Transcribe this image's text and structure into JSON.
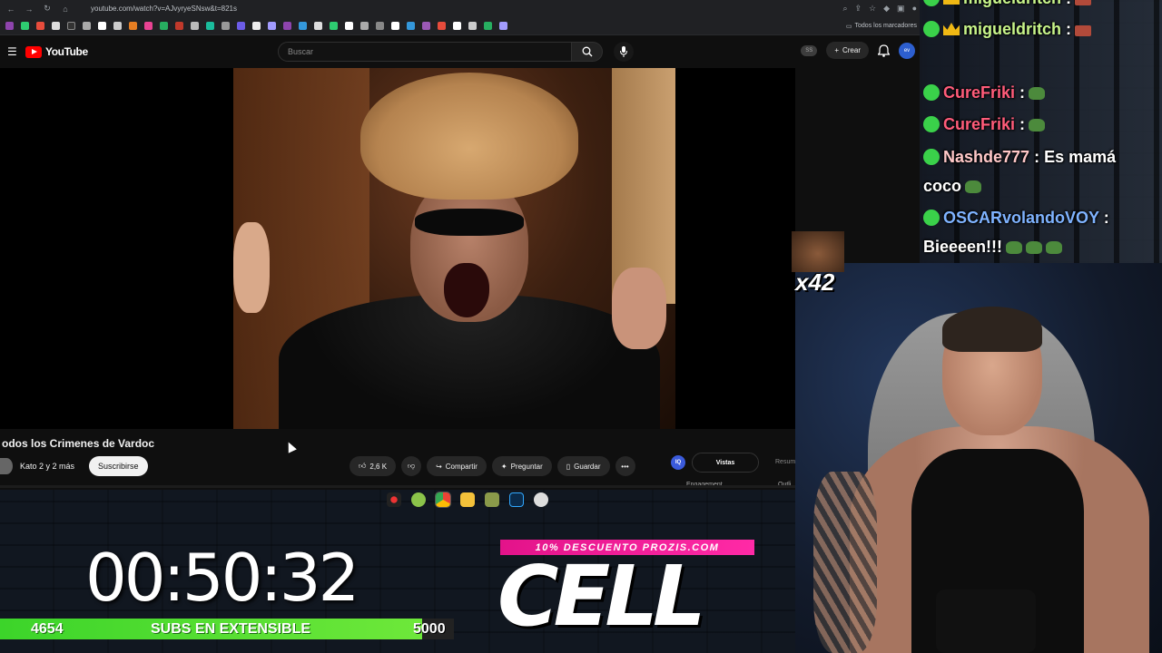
{
  "browser": {
    "url": "youtube.com/watch?v=AJvyryeSNsw&t=821s",
    "bookmarks_folder": "Todos los marcadores"
  },
  "youtube": {
    "logo_text": "YouTube",
    "search_placeholder": "Buscar",
    "ss_badge": "SS",
    "create_label": "Crear",
    "avatar_text": "ev",
    "video_title": "odos los Crimenes de Vardoc",
    "channel_name": "Kato 2 y 2 más",
    "subscribe_label": "Suscribirse",
    "like_count": "2,6 K",
    "share_label": "Compartir",
    "ask_label": "Preguntar",
    "save_label": "Guardar",
    "iq_label": "IQ",
    "tab_views": "Vistas",
    "tab_summary": "Resum",
    "label_engagement": "Engagement",
    "label_outline": "Outli"
  },
  "chat": {
    "messages": [
      {
        "user": "migueldritch",
        "text": ":",
        "color": "green"
      },
      {
        "user": "migueldritch",
        "text": ":",
        "color": "green"
      },
      {
        "user": "CureFriki",
        "text": ":",
        "color": "pink"
      },
      {
        "user": "CureFriki",
        "text": ":",
        "color": "pink"
      },
      {
        "user": "Nashde777",
        "text": ": Es mamá",
        "color": "peach"
      },
      {
        "user": "",
        "text": "coco",
        "color": "white"
      },
      {
        "user": "OSCARvolandoVOY",
        "text": ":",
        "color": "blue"
      },
      {
        "user": "",
        "text": "Bieeeen!!!",
        "color": "white"
      }
    ]
  },
  "emote_multiplier": "x42",
  "stream": {
    "timer": "00:50:32",
    "subs_current": "4654",
    "subs_label": "SUBS EN EXTENSIBLE",
    "subs_goal": "5000",
    "subs_progress": 0.9308,
    "promo_text": "10% DESCUENTO PROZIS.COM",
    "sponsor_logo": "CELL"
  },
  "colors": {
    "youtube_red": "#ff0000",
    "subs_green": "#3cd42a",
    "promo_pink": "#e3138a",
    "chat_green_user": "#c8f58a",
    "chat_pink_user": "#ff5c7a"
  }
}
